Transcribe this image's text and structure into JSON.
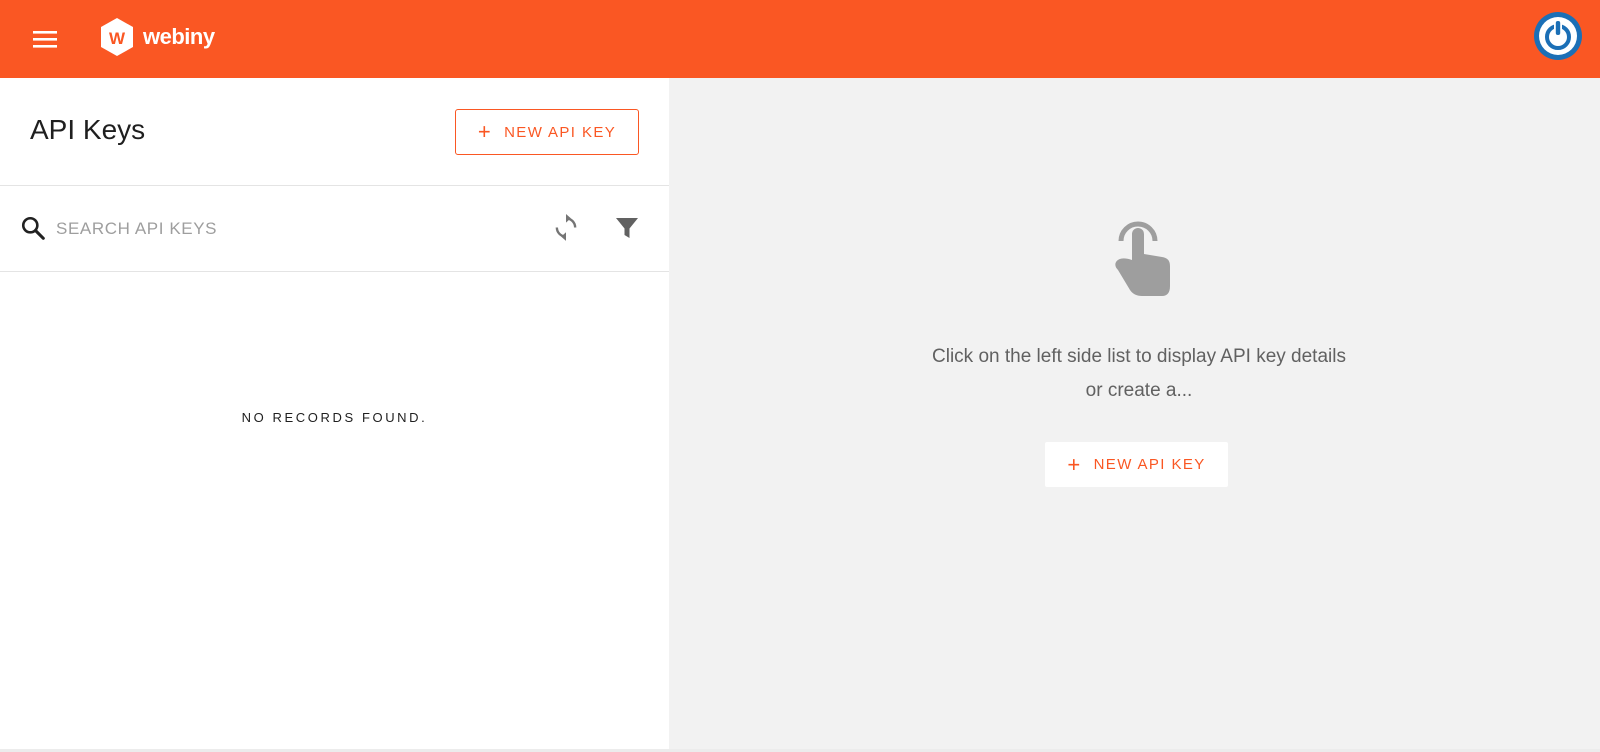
{
  "topbar": {
    "menu_icon": "hamburger-menu-icon",
    "logo_text": "webiny",
    "brand_color": "#fa5723",
    "avatar_icon": "power-avatar-icon"
  },
  "list": {
    "title": "API Keys",
    "new_button_label": "NEW API KEY",
    "search_placeholder": "SEARCH API KEYS",
    "search_value": "",
    "refresh_icon": "refresh-icon",
    "filter_icon": "filter-icon",
    "empty_message": "NO RECORDS FOUND."
  },
  "details": {
    "icon": "touch-hand-icon",
    "help_text": "Click on the left side list to display API key details or create a...",
    "new_button_label": "NEW API KEY"
  }
}
